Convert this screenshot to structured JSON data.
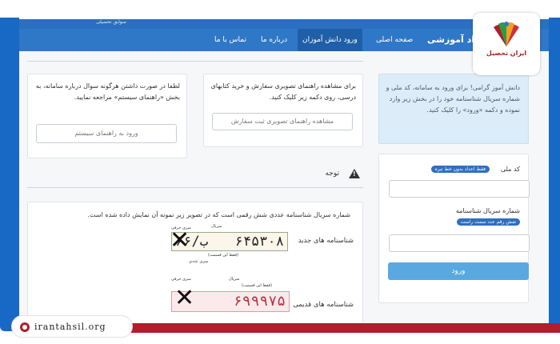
{
  "topstrip_text": "سوابق تحصیلی",
  "navbar": {
    "brand": "مواد آموزشی",
    "brand_prefix": "ف",
    "items": [
      "صفحه اصلی",
      "ورود دانش آموزان",
      "درباره ما",
      "تماس با ما"
    ],
    "active_index": 1
  },
  "order_card": {
    "text": "برای مشاهده راهنمای تصویری سفارش و خرید کتابهای درسی، روی دکمه زیر کلیک کنید.",
    "button": "مشاهده راهنمای تصویری ثبت سفارش"
  },
  "help_card": {
    "text": "لطفا در صورت داشتن هرگونه سوال درباره سامانه، به بخش «راهنمای سیستم» مراجعه نمایید.",
    "button": "ورود به راهنمای سیستم"
  },
  "notice": {
    "label": "توجه",
    "serial_text": "شماره سریال شناسنامه عددی شش رقمی است که در تصویر زیر نمونه آن نمایش داده شده است.",
    "new_label": "شناسنامه های جدید",
    "old_label": "شناسنامه های قدیمی",
    "new_prefix": "ب/۶۶",
    "new_digits": "۶۴۵۳۰۸",
    "old_digits": "۶۹۹۹۷۵",
    "hint_series_letter": "سری حرفی",
    "hint_serial": "سریال",
    "hint_only_this": "(فقط این قسمت)",
    "hint_series_number": "سری عددی"
  },
  "sidebar": {
    "info_text": "دانش آموز گرامی! برای ورود به سامانه، کد ملی و شماره سریال شناسنامه خود را در بخش زیر وارد نموده و دکمه «ورود» را کلیک کنید.",
    "national_code_label": "کد ملی",
    "national_code_hint": "فقط اعداد بدون خط تیره",
    "serial_label": "شماره سریال شناسنامه",
    "serial_hint": "شش رقم عدد سمت راست",
    "submit": "ورود"
  },
  "logo_text": "ایران تحصیل",
  "watermark": "irantahsil.org",
  "colors": {
    "frame_blue": "#1769c5",
    "nav_blue": "#2f78c8",
    "accent_red": "#b01e2b",
    "submit_blue": "#5aa8e0"
  }
}
